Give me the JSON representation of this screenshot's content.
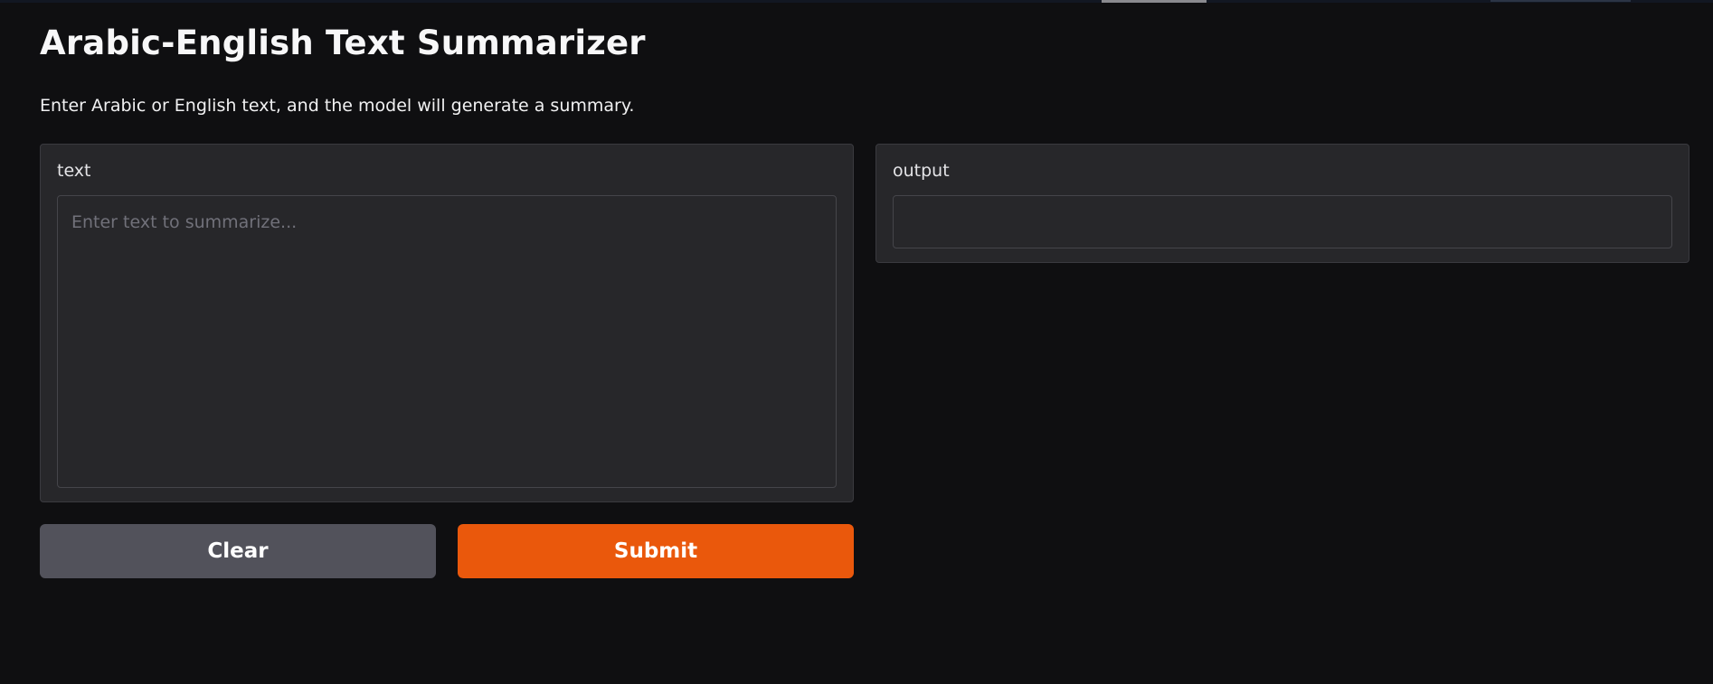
{
  "header": {
    "title": "Arabic-English Text Summarizer",
    "description": "Enter Arabic or English text, and the model will generate a summary."
  },
  "input": {
    "label": "text",
    "value": "",
    "placeholder": "Enter text to summarize..."
  },
  "output": {
    "label": "output",
    "value": ""
  },
  "actions": {
    "clear_label": "Clear",
    "submit_label": "Submit"
  },
  "colors": {
    "background": "#0f0f11",
    "panel": "#27272a",
    "accent": "#ea580c",
    "secondary_button": "#52525b"
  }
}
